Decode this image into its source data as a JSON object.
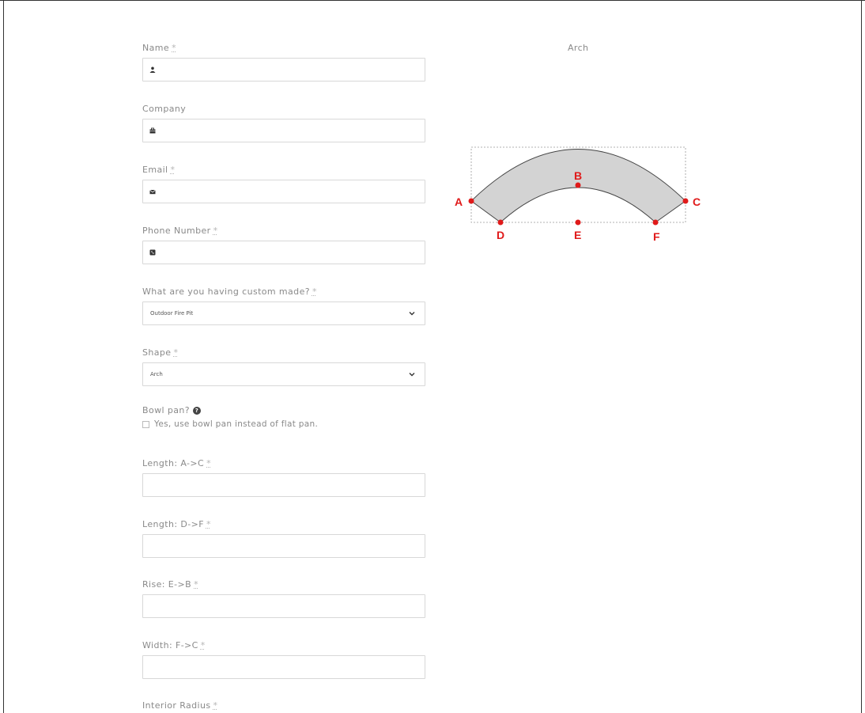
{
  "form": {
    "name": {
      "label": "Name",
      "required": "*",
      "icon": "person-icon",
      "value": ""
    },
    "company": {
      "label": "Company",
      "icon": "briefcase-icon",
      "value": ""
    },
    "email": {
      "label": "Email",
      "required": "*",
      "icon": "envelope-icon",
      "value": ""
    },
    "phone": {
      "label": "Phone Number",
      "required": "*",
      "icon": "phone-icon",
      "value": ""
    },
    "custom_item": {
      "label": "What are you having custom made?",
      "required": "*",
      "selected": "Outdoor Fire Pit"
    },
    "shape": {
      "label": "Shape",
      "required": "*",
      "selected": "Arch"
    },
    "bowl_pan": {
      "label": "Bowl pan?",
      "help_icon": "?",
      "checkbox_label": "Yes, use bowl pan instead of flat pan.",
      "checked": false
    },
    "length_ac": {
      "label": "Length: A->C",
      "required": "*",
      "value": ""
    },
    "length_df": {
      "label": "Length: D->F",
      "required": "*",
      "value": ""
    },
    "rise_eb": {
      "label": "Rise: E->B",
      "required": "*",
      "value": ""
    },
    "width_fc": {
      "label": "Width: F->C",
      "required": "*",
      "value": ""
    },
    "interior_radius": {
      "label": "Interior Radius",
      "required": "*"
    }
  },
  "diagram": {
    "title": "Arch",
    "points": {
      "a": "A",
      "b": "B",
      "c": "C",
      "d": "D",
      "e": "E",
      "f": "F"
    },
    "colors": {
      "fill": "#d3d3d3",
      "marker": "#e01a1a",
      "outline": "#444444"
    }
  }
}
